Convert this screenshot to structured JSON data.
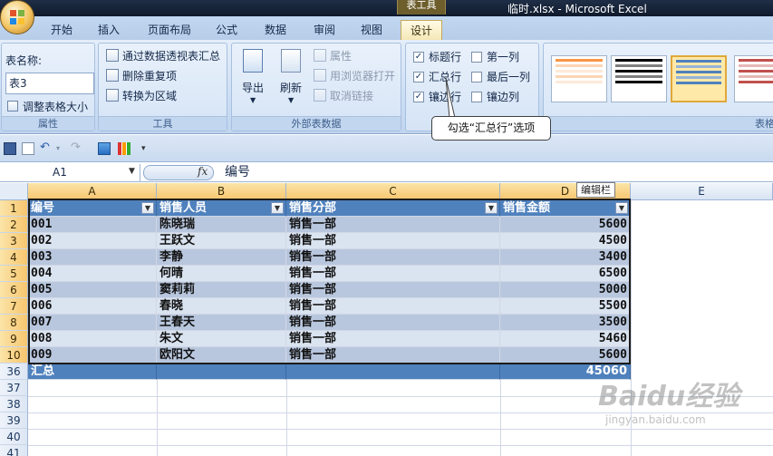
{
  "window": {
    "title": "临时.xlsx - Microsoft Excel",
    "context_tab_label": "表工具"
  },
  "tabs": [
    "开始",
    "插入",
    "页面布局",
    "公式",
    "数据",
    "审阅",
    "视图",
    "设计"
  ],
  "ribbon": {
    "properties": {
      "name_label": "表名称:",
      "name_value": "表3",
      "resize_label": "调整表格大小",
      "group_label": "属性"
    },
    "tools": {
      "items": [
        "通过数据透视表汇总",
        "删除重复项",
        "转换为区域"
      ],
      "group_label": "工具"
    },
    "external": {
      "export_label": "导出",
      "refresh_label": "刷新",
      "items": [
        "属性",
        "用浏览器打开",
        "取消链接"
      ],
      "group_label": "外部表数据"
    },
    "style_options": {
      "header_row": "标题行",
      "total_row": "汇总行",
      "banded_rows": "镶边行",
      "first_column": "第一列",
      "last_column": "最后一列",
      "banded_columns": "镶边列"
    },
    "table_styles": {
      "group_label": "表格"
    }
  },
  "callout": "勾选“汇总行”选项",
  "formula_bar": {
    "cell_ref": "A1",
    "fx": "fx",
    "value": "编号",
    "tooltip": "编辑栏"
  },
  "sheet": {
    "columns": [
      "A",
      "B",
      "C",
      "D",
      "E"
    ],
    "headers": [
      "编号",
      "销售人员",
      "销售分部",
      "销售金额"
    ],
    "row_numbers": [
      "1",
      "2",
      "3",
      "4",
      "5",
      "6",
      "7",
      "8",
      "9",
      "10",
      "36",
      "37",
      "38",
      "39",
      "40",
      "41"
    ],
    "rows": [
      [
        "001",
        "陈晓瑞",
        "销售一部",
        "5600"
      ],
      [
        "002",
        "王跃文",
        "销售一部",
        "4500"
      ],
      [
        "003",
        "李静",
        "销售一部",
        "3400"
      ],
      [
        "004",
        "何晴",
        "销售一部",
        "6500"
      ],
      [
        "005",
        "窦莉莉",
        "销售一部",
        "5000"
      ],
      [
        "006",
        "春晓",
        "销售一部",
        "5500"
      ],
      [
        "007",
        "王春天",
        "销售一部",
        "3500"
      ],
      [
        "008",
        "朱文",
        "销售一部",
        "5460"
      ],
      [
        "009",
        "欧阳文",
        "销售一部",
        "5600"
      ]
    ],
    "total_row": {
      "label": "汇总",
      "value": "45060"
    }
  },
  "watermark": {
    "brand": "Baidu经验",
    "url": "jingyan.baidu.com"
  }
}
